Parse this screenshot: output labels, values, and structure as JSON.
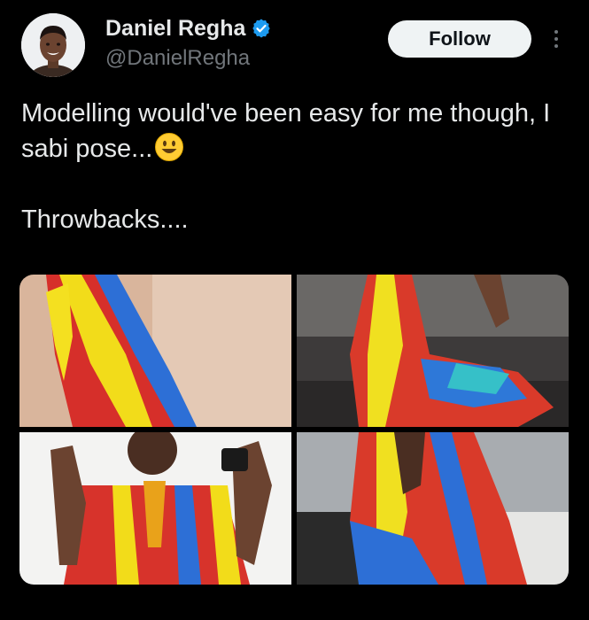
{
  "tweet": {
    "author": {
      "display_name": "Daniel Regha",
      "handle": "@DanielRegha",
      "verified": true,
      "avatar_icon": "avatar-photo"
    },
    "follow_label": "Follow",
    "more_icon": "more-options-icon",
    "text_line_1": "Modelling would've been easy for me though, I sabi pose...",
    "emoji": "smiley-face",
    "text_line_2": "Throwbacks....",
    "media": [
      {
        "description": "photo"
      },
      {
        "description": "photo"
      },
      {
        "description": "photo"
      },
      {
        "description": "photo"
      }
    ]
  },
  "colors": {
    "background": "#000000",
    "text_primary": "#e7e9ea",
    "text_secondary": "#71767b",
    "verified_blue": "#1d9bf0",
    "follow_bg": "#eff3f4"
  }
}
